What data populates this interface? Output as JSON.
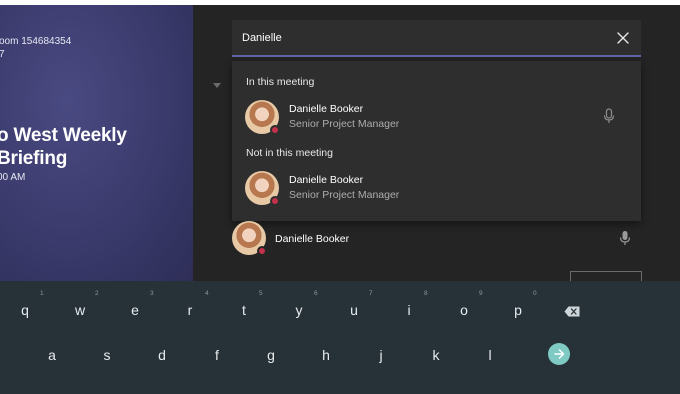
{
  "meeting": {
    "room_line1": "oom 154684354",
    "room_line2": "7",
    "title_line1": "o West Weekly",
    "title_line2": " Briefing",
    "time": "00 AM"
  },
  "search": {
    "value": "Danielle",
    "clear_icon": "close-icon"
  },
  "results": {
    "in_meeting_header": "In this meeting",
    "not_in_meeting_header": "Not in this meeting",
    "in_meeting": [
      {
        "name": "Danielle Booker",
        "role": "Senior Project Manager",
        "mic_icon": "microphone-icon"
      }
    ],
    "not_in_meeting": [
      {
        "name": "Danielle Booker",
        "role": "Senior Project Manager"
      }
    ]
  },
  "participant": {
    "name": "Danielle Booker",
    "mic_icon": "microphone-icon"
  },
  "colors": {
    "accent": "#6264a7",
    "presence_busy": "#c4314b",
    "keyboard_bg": "#263238",
    "enter_key": "#7fcbc4"
  },
  "keyboard": {
    "row1": [
      {
        "key": "q",
        "hint": "1"
      },
      {
        "key": "w",
        "hint": "2"
      },
      {
        "key": "e",
        "hint": "3"
      },
      {
        "key": "r",
        "hint": "4"
      },
      {
        "key": "t",
        "hint": "5"
      },
      {
        "key": "y",
        "hint": "6"
      },
      {
        "key": "u",
        "hint": "7"
      },
      {
        "key": "i",
        "hint": "8"
      },
      {
        "key": "o",
        "hint": "9"
      },
      {
        "key": "p",
        "hint": "0"
      }
    ],
    "row2": [
      "a",
      "s",
      "d",
      "f",
      "g",
      "h",
      "j",
      "k",
      "l"
    ],
    "backspace_icon": "backspace-icon",
    "enter_icon": "arrow-right-icon"
  }
}
